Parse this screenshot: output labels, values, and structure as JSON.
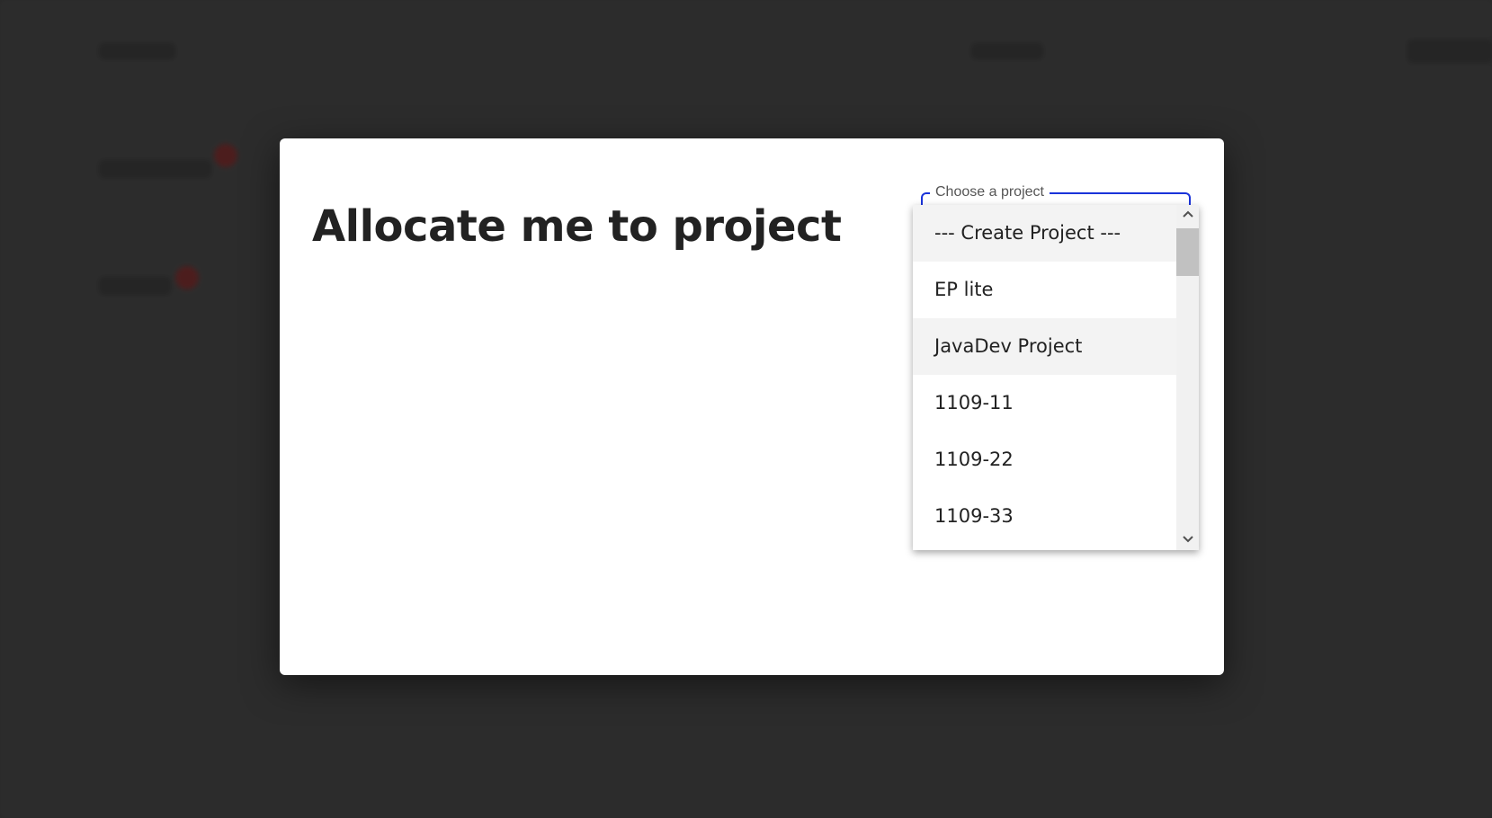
{
  "modal": {
    "title": "Allocate me to project"
  },
  "project_select": {
    "label": "Choose a project",
    "options": [
      "--- Create Project ---",
      "EP lite",
      "JavaDev Project",
      "1109-11",
      "1109-22",
      "1109-33"
    ]
  },
  "icons": {
    "scroll_up": "chevron-up-icon",
    "scroll_down": "chevron-down-icon"
  },
  "colors": {
    "accent": "#1a33d9",
    "backdrop": "#363636"
  }
}
